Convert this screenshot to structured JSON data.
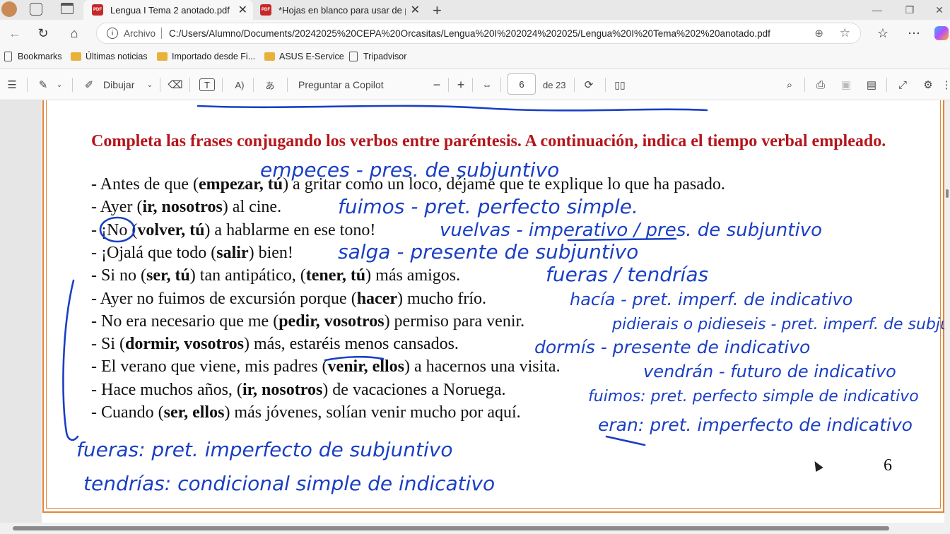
{
  "browser": {
    "tabs": [
      {
        "title": "Lengua I Tema 2 anotado.pdf",
        "icon": "pdf-icon"
      },
      {
        "title": "*Hojas en blanco para usar de piz",
        "icon": "pdf-icon"
      }
    ],
    "address": {
      "scheme_label": "Archivo",
      "url": "C:/Users/Alumno/Documents/20242025%20CEPA%20Orcasitas/Lengua%20I%202024%202025/Lengua%20I%20Tema%202%20anotado.pdf"
    },
    "bookmarks": [
      "Bookmarks",
      "Últimas noticias",
      "Importado desde Fi...",
      "ASUS E-Service",
      "Tripadvisor"
    ]
  },
  "pdf_toolbar": {
    "draw_label": "Dibujar",
    "copilot_label": "Preguntar a Copilot",
    "page_current": "6",
    "page_total_label": "de 23"
  },
  "document": {
    "title": "Completa las frases conjugando los verbos entre paréntesis. A continuación, indica el tiempo verbal empleado.",
    "lines": [
      [
        {
          "t": "- Antes de que ("
        },
        {
          "t": "empezar, tú",
          "b": true
        },
        {
          "t": ") a gritar como un loco, déjame que te explique lo que ha pasado."
        }
      ],
      [
        {
          "t": "- Ayer ("
        },
        {
          "t": "ir, nosotros",
          "b": true
        },
        {
          "t": ") al cine."
        }
      ],
      [
        {
          "t": "- ¡No ("
        },
        {
          "t": "volver, tú",
          "b": true
        },
        {
          "t": ") a hablarme en ese tono!"
        }
      ],
      [
        {
          "t": "- ¡Ojalá que todo ("
        },
        {
          "t": "salir",
          "b": true
        },
        {
          "t": ") bien!"
        }
      ],
      [
        {
          "t": "- Si no ("
        },
        {
          "t": "ser, tú",
          "b": true
        },
        {
          "t": ") tan antipático, ("
        },
        {
          "t": "tener, tú",
          "b": true
        },
        {
          "t": ") más amigos."
        }
      ],
      [
        {
          "t": "- Ayer no fuimos de excursión porque ("
        },
        {
          "t": "hacer",
          "b": true
        },
        {
          "t": ") mucho frío."
        }
      ],
      [
        {
          "t": "- No era necesario que me ("
        },
        {
          "t": "pedir, vosotros",
          "b": true
        },
        {
          "t": ") permiso para venir."
        }
      ],
      [
        {
          "t": "- Si ("
        },
        {
          "t": "dormir, vosotros",
          "b": true
        },
        {
          "t": ") más, estaréis menos cansados."
        }
      ],
      [
        {
          "t": "- El verano que viene, mis padres ("
        },
        {
          "t": "venir, ellos",
          "b": true
        },
        {
          "t": ") a hacernos una visita."
        }
      ],
      [
        {
          "t": "- Hace muchos años, ("
        },
        {
          "t": "ir, nosotros",
          "b": true
        },
        {
          "t": ") de vacaciones a Noruega."
        }
      ],
      [
        {
          "t": "- Cuando ("
        },
        {
          "t": "ser, ellos",
          "b": true
        },
        {
          "t": ") más jóvenes, solían venir mucho por aquí."
        }
      ]
    ],
    "page_number": "6",
    "handwritten_notes": [
      "empeces - pres. de subjuntivo",
      "fuimos - pret. perfecto simple.",
      "vuelvas - imperativo / pres. de subjuntivo",
      "salga - presente de subjuntivo",
      "fueras / tendrías",
      "hacía - pret. imperf. de indicativo",
      "pidierais o pidieseis - pret. imperf. de subjuntivo",
      "dormís - presente de indicativo",
      "vendrán - futuro de indicativo",
      "fuimos: pret. perfecto simple de indicativo",
      "eran: pret. imperfecto de indicativo",
      "fueras: pret. imperfecto de subjuntivo",
      "tendrías: condicional simple de indicativo"
    ],
    "ink_color": "#1a3fc4",
    "heading_color": "#b5141a"
  }
}
